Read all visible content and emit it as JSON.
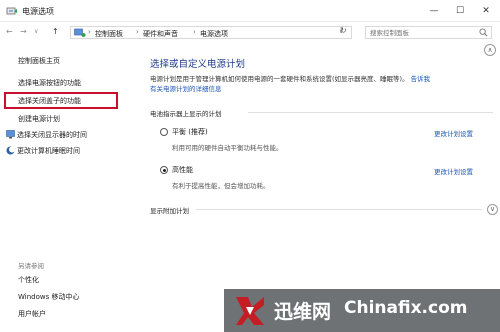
{
  "window": {
    "title": "电源选项",
    "min_glyph": "—",
    "max_glyph": "☐",
    "close_glyph": "✕"
  },
  "address": {
    "back_glyph": "←",
    "forward_glyph": "→",
    "history_glyph": "∨",
    "up_glyph": "↑",
    "separator": "›",
    "crumbs": [
      "控制面板",
      "硬件和声音",
      "电源选项"
    ],
    "dropdown_glyph": "∨",
    "refresh_glyph": "↻",
    "search_placeholder": "搜索控制面板"
  },
  "sidebar": {
    "home": "控制面板主页",
    "links": [
      "选择电源按钮的功能",
      "选择关闭盖子的功能",
      "创建电源计划",
      "选择关闭显示器的时间",
      "更改计算机睡眠时间"
    ],
    "see_also_label": "另请参阅",
    "see_also": [
      "个性化",
      "Windows 移动中心",
      "用户帐户"
    ]
  },
  "main": {
    "heading": "选择或自定义电源计划",
    "intro_text": "电源计划是用于管理计算机如何使用电源的一套硬件和系统设置(如显示器亮度、睡眠等)。",
    "intro_link_1": "告诉我",
    "intro_link_2": "有关电源计划的详细信息",
    "section_label": "电池指示器上显示的计划",
    "plans": [
      {
        "name": "平衡 (推荐)",
        "description": "利用可用的硬件自动平衡功耗与性能。",
        "link": "更改计划设置",
        "selected": false
      },
      {
        "name": "高性能",
        "description": "有利于提高性能，但会增加功耗。",
        "link": "更改计划设置",
        "selected": true
      }
    ],
    "extra_label": "显示附加计划",
    "expand_glyph": "∨",
    "scroll_up_glyph": "∧"
  },
  "watermark": {
    "brand_cn": "迅维网",
    "brand_en": "Chinafix.com",
    "logo_color": "#c41d23"
  },
  "colors": {
    "highlight_box": "#c8102e",
    "link": "#1a56b8",
    "heading": "#1e3a8a"
  }
}
